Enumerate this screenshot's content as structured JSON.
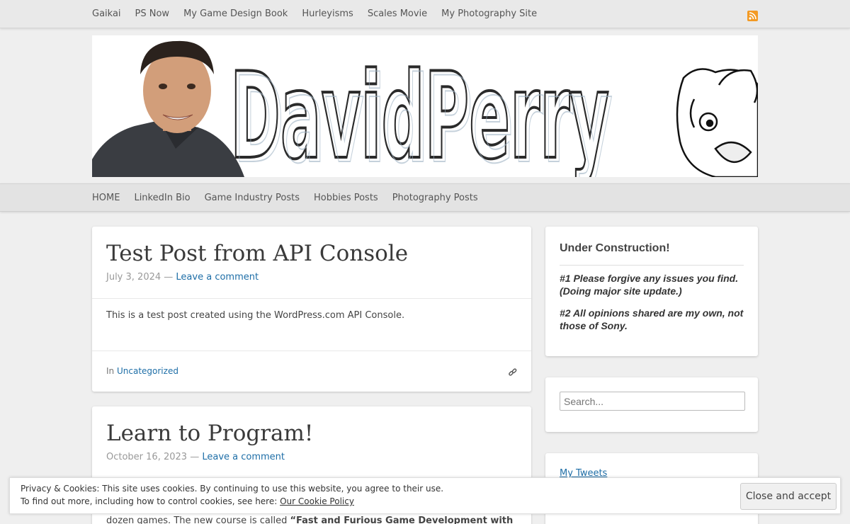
{
  "top_nav": {
    "items": [
      "Gaikai",
      "PS Now",
      "My Game Design Book",
      "Hurleyisms",
      "Scales Movie",
      "My Photography Site"
    ]
  },
  "banner": {
    "logo_text": "DavidPerry"
  },
  "main_nav": {
    "items": [
      "HOME",
      "LinkedIn Bio",
      "Game Industry Posts",
      "Hobbies Posts",
      "Photography Posts"
    ]
  },
  "posts": [
    {
      "title": "Test Post from API Console",
      "date": "July 3, 2024",
      "separator": "—",
      "comment_link": "Leave a comment",
      "body": "This is a test post created using the WordPress.com API Console.",
      "category_prefix": "In",
      "category": "Uncategorized"
    },
    {
      "title": "Learn to Program!",
      "date": "October 16, 2023",
      "separator": "—",
      "comment_link": "Leave a comment",
      "body_partial_plain": "dozen games. The new course is called ",
      "body_partial_bold": "“Fast and Furious Game Development with"
    }
  ],
  "sidebar": {
    "construction": {
      "title": "Under Construction!",
      "line1": "#1 Please forgive any issues you find. (Doing major site update.)",
      "line2": "#2 All opinions shared are my own, not those of Sony."
    },
    "search": {
      "placeholder": "Search..."
    },
    "tweets": {
      "link": "My Tweets"
    }
  },
  "cookie_banner": {
    "line1": "Privacy & Cookies: This site uses cookies. By continuing to use this website, you agree to their use.",
    "line2_prefix": "To find out more, including how to control cookies, see here: ",
    "policy_link": "Our Cookie Policy",
    "accept_button": "Close and accept"
  },
  "colors": {
    "link": "#1e6ea7",
    "rss": "#f39a24",
    "background": "#efefef"
  }
}
